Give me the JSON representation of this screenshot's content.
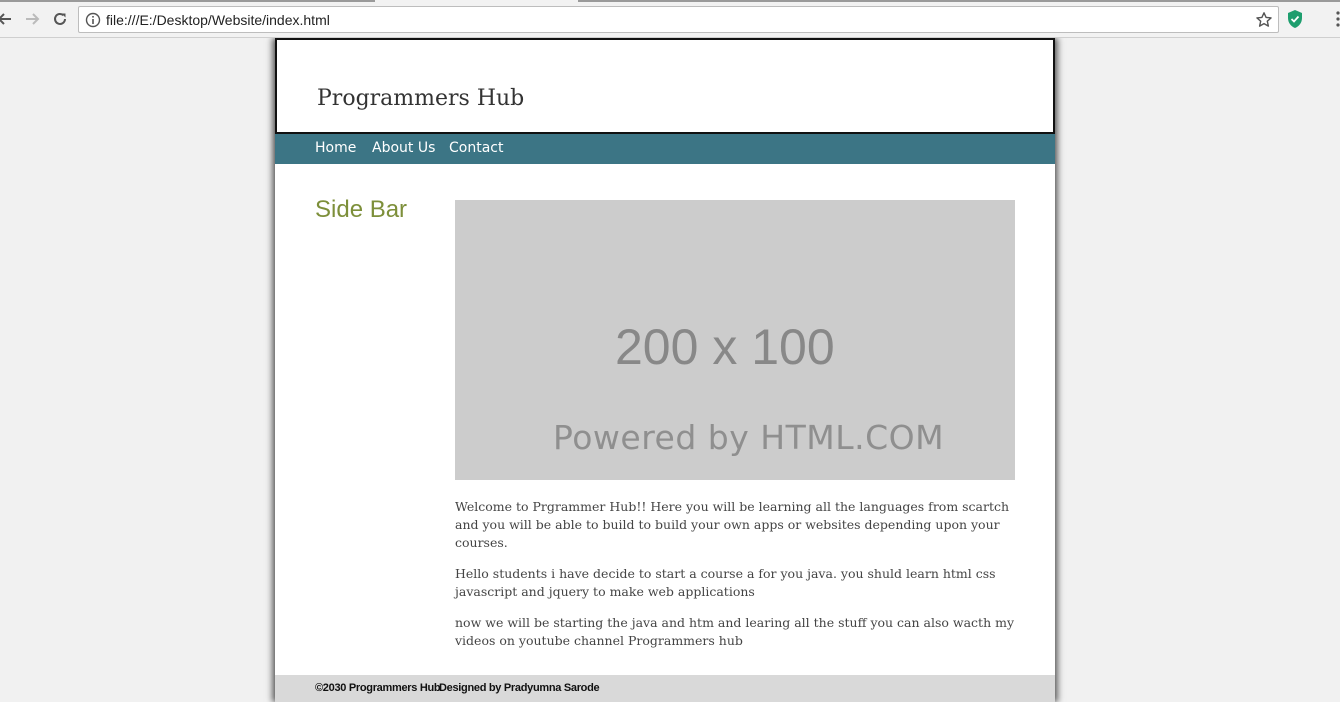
{
  "browser": {
    "url": "file:///E:/Desktop/Website/index.html",
    "icons": {
      "back": "back-arrow-icon",
      "forward": "forward-arrow-icon",
      "reload": "reload-icon",
      "info": "info-icon",
      "star": "bookmark-star-icon",
      "extension": "shield-extension-icon"
    },
    "colors": {
      "extension": "#1e9e6e"
    }
  },
  "site": {
    "title": "Programmers Hub",
    "nav": [
      "Home",
      "About Us",
      "Contact"
    ],
    "sidebar_title": "Side Bar",
    "placeholder": {
      "dimensions": "200 x 100",
      "powered_by": "Powered by HTML.COM"
    },
    "paragraphs": [
      "Welcome to Prgrammer Hub!! Here you will be learning all the languages from scartch and you will be able to build to build your own apps or websites depending upon your courses.",
      "Hello students i have decide to start a course a for you java. you shuld learn html css javascript and jquery to make web applications",
      "now we will be starting the java and htm and learing all the stuff you can also wacth my videos on youtube channel Programmers hub"
    ],
    "footer": {
      "copyright": "©2030 Programmers Hub",
      "designed_by_label": "Designed by",
      "designer": "Pradyumna Sarode"
    },
    "colors": {
      "nav_bg": "#3c7585",
      "sidebar_title": "#7d8f3a",
      "footer_bg": "#d9d9d9",
      "placeholder_bg": "#cccccc"
    }
  }
}
